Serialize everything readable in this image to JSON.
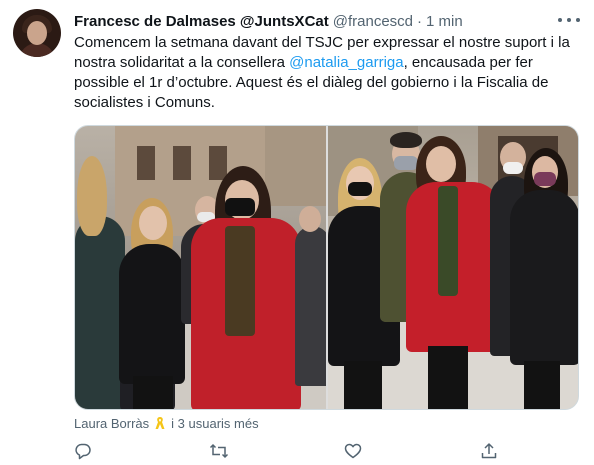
{
  "tweet": {
    "author_name": "Francesc de Dalmases @JuntsXCat",
    "handle": "@francescd",
    "separator": "·",
    "time": "1 min",
    "text_part1": "Comencem la setmana davant del TSJC per expressar el nostre suport i la nostra solidaritat a la consellera ",
    "mention": "@natalia_garriga",
    "text_part2": ", encausada per fer possible el 1r d’octubre. Aquest és el diàleg del gobierno i la Fiscalia de socialistes i Comuns.",
    "liked_by_name": "Laura Borràs",
    "liked_by_rest": "i 3 usuaris més"
  },
  "icons": {
    "more": "more-horizontal-icon",
    "reply": "reply-icon",
    "retweet": "retweet-icon",
    "like": "heart-icon",
    "share": "share-icon",
    "ribbon": "yellow-ribbon-icon"
  },
  "colors": {
    "text": "#0f1419",
    "secondary": "#536471",
    "link": "#1d9bf0",
    "ribbon": "#f5c518",
    "coat_red": "#c0202a"
  }
}
